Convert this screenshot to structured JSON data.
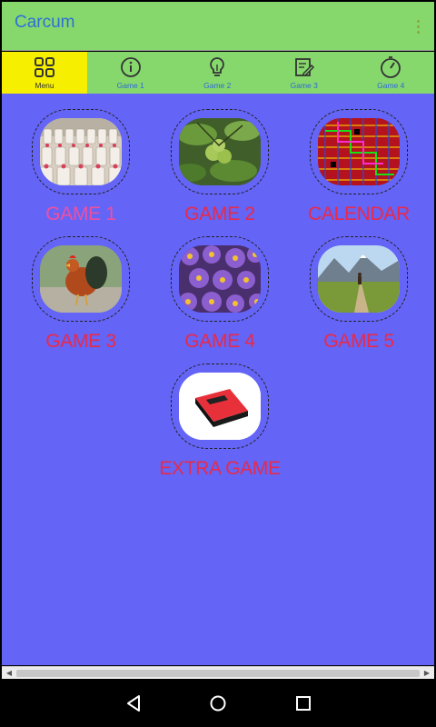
{
  "app": {
    "title": "Carcum"
  },
  "tabs": [
    {
      "label": "Menu",
      "icon": "grid-icon",
      "active": true
    },
    {
      "label": "Game 1",
      "icon": "info-icon",
      "active": false
    },
    {
      "label": "Game 2",
      "icon": "lightbulb-icon",
      "active": false
    },
    {
      "label": "Game 3",
      "icon": "edit-note-icon",
      "active": false
    },
    {
      "label": "Game 4",
      "icon": "timer-icon",
      "active": false
    }
  ],
  "tiles": [
    {
      "label": "GAME 1",
      "image": "wedding-chairs-photo"
    },
    {
      "label": "GAME 2",
      "image": "green-fruit-leaves-photo"
    },
    {
      "label": "CALENDAR",
      "image": "colorful-grid-pattern"
    },
    {
      "label": "GAME 3",
      "image": "rooster-photo"
    },
    {
      "label": "GAME 4",
      "image": "purple-daisies-photo"
    },
    {
      "label": "GAME 5",
      "image": "mountain-trail-photo"
    },
    {
      "label": "EXTRA GAME",
      "image": "red-game-cartridge-icon"
    }
  ],
  "colors": {
    "appbar": "#86d86d",
    "active_tab": "#f6ef00",
    "content_bg": "#6464f6",
    "label_red": "#e82a4a",
    "title_blue": "#2e6fd6"
  }
}
